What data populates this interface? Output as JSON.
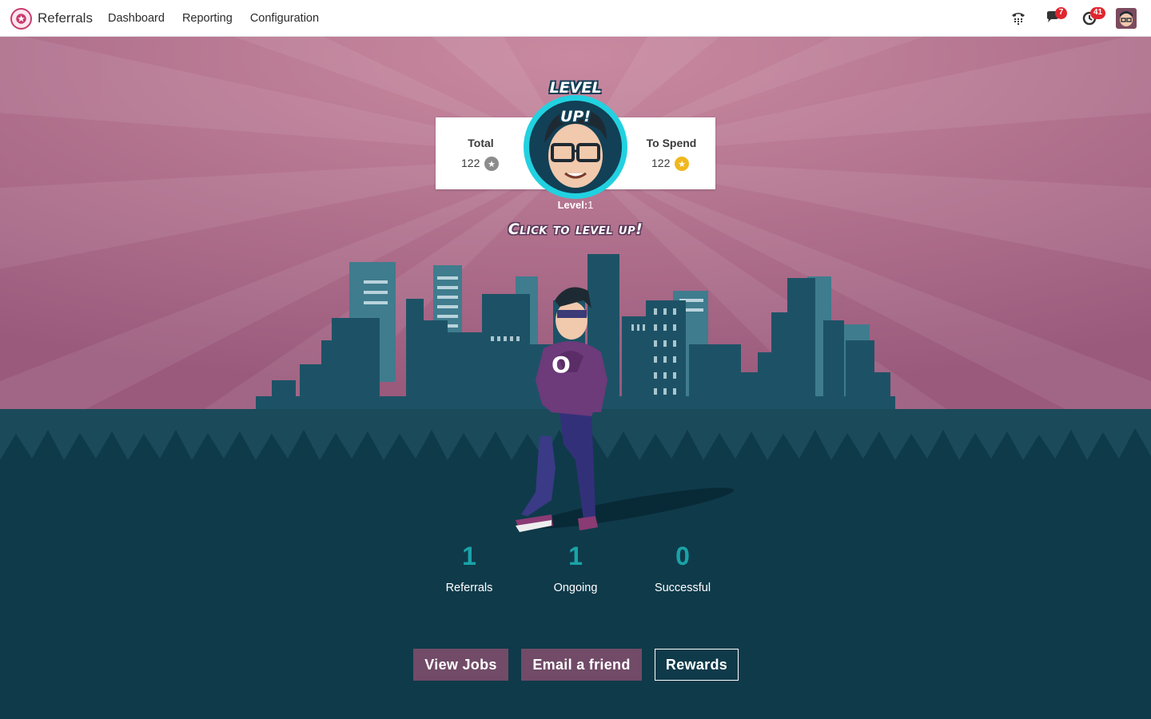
{
  "navbar": {
    "app_name": "Referrals",
    "menu": [
      "Dashboard",
      "Reporting",
      "Configuration"
    ],
    "systray": {
      "phone_icon": "phone-icon",
      "messages_badge": "7",
      "activities_badge": "41"
    }
  },
  "hero": {
    "level_up_badge": "LEVEL UP!",
    "points": {
      "total_label": "Total",
      "total_value": "122",
      "to_spend_label": "To Spend",
      "to_spend_value": "122"
    },
    "level_label": "Level:",
    "level_value": "1",
    "click_to_level_up": "Click to level up!"
  },
  "stats": [
    {
      "value": "1",
      "label": "Referrals"
    },
    {
      "value": "1",
      "label": "Ongoing"
    },
    {
      "value": "0",
      "label": "Successful"
    }
  ],
  "actions": {
    "view_jobs": "View Jobs",
    "email_friend": "Email a friend",
    "rewards": "Rewards"
  },
  "colors": {
    "sky": "#b5728d",
    "ground": "#0f3a4a",
    "accent": "#714b67",
    "ring": "#22d1e0",
    "stat_number": "#1aa3a8"
  }
}
